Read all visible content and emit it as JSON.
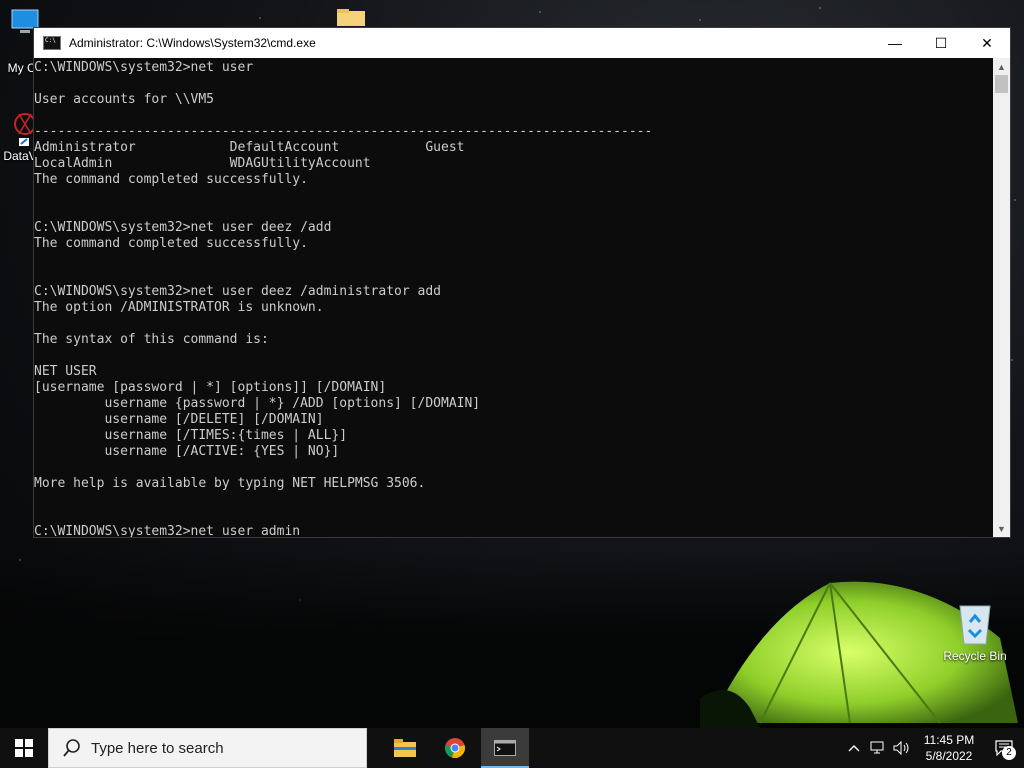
{
  "desktop": {
    "icons": [
      {
        "label": "My Co"
      },
      {
        "label": "DataV"
      },
      {
        "label": "Recycle Bin"
      }
    ]
  },
  "window": {
    "title": "Administrator: C:\\Windows\\System32\\cmd.exe",
    "minimize_label": "—",
    "maximize_label": "☐",
    "close_label": "✕",
    "console_text": "C:\\WINDOWS\\system32>net user\n\nUser accounts for \\\\VM5\n\n-------------------------------------------------------------------------------\nAdministrator            DefaultAccount           Guest\nLocalAdmin               WDAGUtilityAccount\nThe command completed successfully.\n\n\nC:\\WINDOWS\\system32>net user deez /add\nThe command completed successfully.\n\n\nC:\\WINDOWS\\system32>net user deez /administrator add\nThe option /ADMINISTRATOR is unknown.\n\nThe syntax of this command is:\n\nNET USER\n[username [password | *] [options]] [/DOMAIN]\n         username {password | *} /ADD [options] [/DOMAIN]\n         username [/DELETE] [/DOMAIN]\n         username [/TIMES:{times | ALL}]\n         username [/ACTIVE: {YES | NO}]\n\nMore help is available by typing NET HELPMSG 3506.\n\n\nC:\\WINDOWS\\system32>net user admin",
    "scroll_up": "▲",
    "scroll_down": "▼"
  },
  "taskbar": {
    "search_placeholder": "Type here to search",
    "apps": [
      "file-explorer",
      "chrome",
      "cmd"
    ],
    "time": "11:45 PM",
    "date": "5/8/2022",
    "notification_count": "2",
    "tray_icons": [
      "chevron-up-icon",
      "network-icon",
      "volume-icon"
    ]
  },
  "colors": {
    "console_bg": "#0c0c0c",
    "console_text": "#cccccc",
    "taskbar_bg": "#101010",
    "accent": "#76b9ed"
  }
}
